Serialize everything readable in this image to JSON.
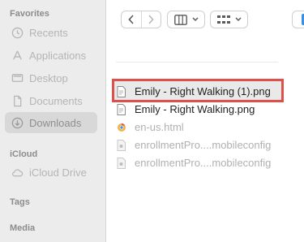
{
  "sidebar": {
    "favorites_title": "Favorites",
    "favorites": [
      {
        "label": "Recents",
        "icon": "clock-icon"
      },
      {
        "label": "Applications",
        "icon": "applications-icon"
      },
      {
        "label": "Desktop",
        "icon": "desktop-icon"
      },
      {
        "label": "Documents",
        "icon": "document-icon"
      },
      {
        "label": "Downloads",
        "icon": "download-icon",
        "selected": true
      }
    ],
    "icloud_title": "iCloud",
    "icloud": [
      {
        "label": "iCloud Drive",
        "icon": "cloud-icon"
      }
    ],
    "tags_title": "Tags",
    "media_title": "Media"
  },
  "files": [
    {
      "name": "Emily - Right Walking (1).png",
      "icon": "png-file-icon",
      "highlighted": true
    },
    {
      "name": "Emily - Right Walking.png",
      "icon": "png-file-icon"
    },
    {
      "name": "en-us.html",
      "icon": "html-file-icon",
      "dimmed": true
    },
    {
      "name": "enrollmentPro....mobileconfig",
      "icon": "config-file-icon",
      "dimmed": true
    },
    {
      "name": "enrollmentPro....mobileconfig",
      "icon": "config-file-icon",
      "dimmed": true
    }
  ],
  "colors": {
    "highlight_border": "#e0504a",
    "sidebar_bg": "#ececec",
    "selected_item_bg": "#d8d8d8"
  }
}
